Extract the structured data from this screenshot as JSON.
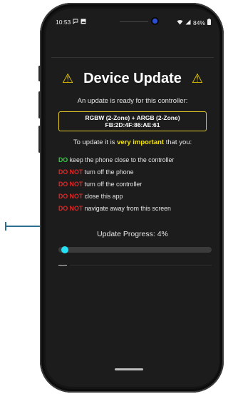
{
  "status_bar": {
    "time": "10:53",
    "battery": "84%",
    "left_icons": [
      "chat-icon",
      "gallery-icon"
    ],
    "right_icons": [
      "wifi-icon",
      "signal-icon",
      "battery-icon"
    ]
  },
  "header": {
    "title": "Device Update",
    "icon": "warning-icon",
    "icon_glyph": "⚠",
    "accent_color": "#f5d400"
  },
  "subtitle": "An update is ready for this controller:",
  "device": {
    "line1": "RGBW (2-Zone) + ARGB (2-Zone)",
    "line2": "FB:2D:4F:86:AE:61"
  },
  "instructions": {
    "prefix": "To update it is ",
    "highlight": "very important",
    "suffix": " that you:"
  },
  "rules": [
    {
      "tag": "DO",
      "text": " keep the phone close to the controller",
      "tag_color": "#2fcf3f"
    },
    {
      "tag": "DO NOT",
      "text": " turn off the phone",
      "tag_color": "#ee2222"
    },
    {
      "tag": "DO NOT",
      "text": " turn off the controller",
      "tag_color": "#ee2222"
    },
    {
      "tag": "DO NOT",
      "text": " close this app",
      "tag_color": "#ee2222"
    },
    {
      "tag": "DO NOT",
      "text": " navigate away from this screen",
      "tag_color": "#ee2222"
    }
  ],
  "progress": {
    "label": "Update Progress: 4%",
    "value_percent": 4,
    "thumb_color": "#26e0f5"
  }
}
